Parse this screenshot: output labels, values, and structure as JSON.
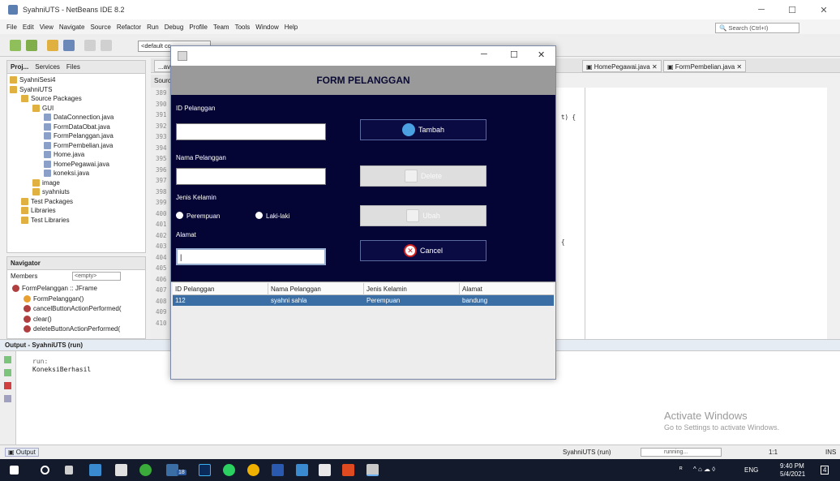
{
  "window": {
    "title": "SyahniUTS - NetBeans IDE 8.2"
  },
  "menu": [
    "File",
    "Edit",
    "View",
    "Navigate",
    "Source",
    "Refactor",
    "Run",
    "Debug",
    "Profile",
    "Team",
    "Tools",
    "Window",
    "Help"
  ],
  "search": {
    "placeholder": "Search (Ctrl+I)"
  },
  "toolbar": {
    "config": "<default co"
  },
  "projects": {
    "tabs": [
      "Proj...",
      "Services",
      "Files"
    ],
    "tree": [
      {
        "label": "SyahniSesi4",
        "depth": 0
      },
      {
        "label": "SyahniUTS",
        "depth": 0
      },
      {
        "label": "Source Packages",
        "depth": 1
      },
      {
        "label": "GUI",
        "depth": 2
      },
      {
        "label": "DataConnection.java",
        "depth": 3
      },
      {
        "label": "FormDataObat.java",
        "depth": 3
      },
      {
        "label": "FormPelanggan.java",
        "depth": 3
      },
      {
        "label": "FormPembelian.java",
        "depth": 3
      },
      {
        "label": "Home.java",
        "depth": 3
      },
      {
        "label": "HomePegawai.java",
        "depth": 3
      },
      {
        "label": "koneksi.java",
        "depth": 3
      },
      {
        "label": "image",
        "depth": 2
      },
      {
        "label": "syahniuts",
        "depth": 2
      },
      {
        "label": "Test Packages",
        "depth": 1
      },
      {
        "label": "Libraries",
        "depth": 1
      },
      {
        "label": "Test Libraries",
        "depth": 1
      }
    ]
  },
  "navigator": {
    "title": "Navigator",
    "members": "Members",
    "filter": "<empty>",
    "items": [
      "FormPelanggan :: JFrame",
      "FormPelanggan()",
      "cancelButtonActionPerformed(",
      "clear()",
      "deleteButtonActionPerformed("
    ]
  },
  "editor": {
    "tabs": [
      "...av",
      "HomePegawai.java",
      "FormPembelian.java"
    ],
    "source_tab": "Sourc",
    "lines": [
      "389",
      "390",
      "391",
      "392",
      "393",
      "394",
      "395",
      "396",
      "397",
      "398",
      "399",
      "400",
      "401",
      "402",
      "403",
      "404",
      "405",
      "406",
      "407",
      "408",
      "409",
      "410"
    ],
    "code_fragments": [
      {
        "text": "t) {"
      },
      {
        "text": "{"
      }
    ]
  },
  "output": {
    "title": "Output - SyahniUTS (run)",
    "lines": [
      "run:",
      "KoneksiBerhasil"
    ],
    "tab": "Output"
  },
  "status": {
    "project": "SyahniUTS (run)",
    "state": "running...",
    "position": "1:1",
    "mode": "INS"
  },
  "activate": {
    "line1": "Activate Windows",
    "line2": "Go to Settings to activate Windows."
  },
  "taskbar": {
    "time": "9:40 PM",
    "date": "5/4/2021",
    "lang": "ENG",
    "badge": "18",
    "notif": "4"
  },
  "form": {
    "heading": "FORM PELANGGAN",
    "label_id": "ID Pelanggan",
    "label_nama": "Nama Pelanggan",
    "label_jk": "Jenis Kelamin",
    "label_alamat": "Alamat",
    "radio_perempuan": "Perempuan",
    "radio_laki": "Laki-laki",
    "id_value": "",
    "nama_value": "",
    "alamat_value": "|",
    "btn_tambah": "Tambah",
    "btn_delete": "Delete",
    "btn_ubah": "Ubah",
    "btn_cancel": "Cancel"
  },
  "table": {
    "headers": [
      "ID Pelanggan",
      "Nama Pelanggan",
      "Jenis Kelamin",
      "Alamat"
    ],
    "rows": [
      [
        "112",
        "syahni sahla",
        "Perempuan",
        "bandung"
      ]
    ]
  },
  "colors": {
    "form_bg": "#050535",
    "header_gray": "#9a9a9a",
    "selection": "#3a6ea5",
    "taskbar": "#121a2b"
  }
}
